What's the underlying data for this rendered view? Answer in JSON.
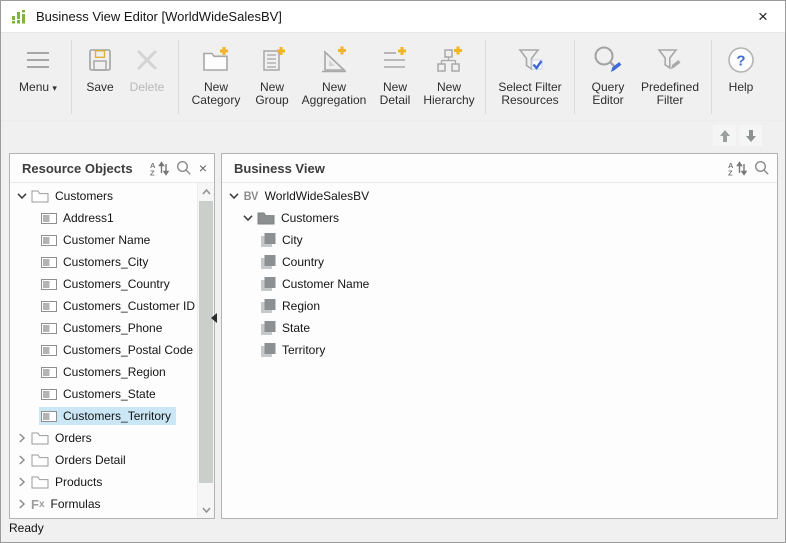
{
  "window": {
    "title": "Business View Editor [WorldWideSalesBV]"
  },
  "icons": {
    "close_window": "×",
    "dropdown_arrow": "▾",
    "panel_close": "×"
  },
  "colors": {
    "selection": "#cbe7f6",
    "brand_green": "#7cb342",
    "accent_yellow": "#f0b429",
    "accent_blue": "#3f6ad8",
    "toolbar_bg": "#f0f0f0"
  },
  "toolbar": {
    "menu_label": "Menu",
    "save_label": "Save",
    "delete_label": "Delete",
    "new_category_label": "New Category",
    "new_group_label": "New Group",
    "new_aggregation_label": "New Aggregation",
    "new_detail_label": "New Detail",
    "new_hierarchy_label": "New Hierarchy",
    "select_filter_label": "Select Filter Resources",
    "query_editor_label": "Query Editor",
    "predefined_filter_label": "Predefined Filter",
    "help_label": "Help"
  },
  "left_panel": {
    "title": "Resource Objects",
    "tree": [
      {
        "label": "Customers",
        "type": "folder",
        "state": "expanded",
        "level": 0
      },
      {
        "label": "Address1",
        "type": "field",
        "level": 1
      },
      {
        "label": "Customer Name",
        "type": "field",
        "level": 1
      },
      {
        "label": "Customers_City",
        "type": "field",
        "level": 1
      },
      {
        "label": "Customers_Country",
        "type": "field",
        "level": 1
      },
      {
        "label": "Customers_Customer ID",
        "type": "field",
        "level": 1
      },
      {
        "label": "Customers_Phone",
        "type": "field",
        "level": 1
      },
      {
        "label": "Customers_Postal Code",
        "type": "field",
        "level": 1
      },
      {
        "label": "Customers_Region",
        "type": "field",
        "level": 1
      },
      {
        "label": "Customers_State",
        "type": "field",
        "level": 1
      },
      {
        "label": "Customers_Territory",
        "type": "field",
        "level": 1,
        "selected": true
      },
      {
        "label": "Orders",
        "type": "folder",
        "state": "collapsed",
        "level": 0
      },
      {
        "label": "Orders Detail",
        "type": "folder",
        "state": "collapsed",
        "level": 0
      },
      {
        "label": "Products",
        "type": "folder",
        "state": "collapsed",
        "level": 0
      },
      {
        "label": "Formulas",
        "type": "formula",
        "state": "collapsed",
        "level": 0
      }
    ]
  },
  "right_panel": {
    "title": "Business View",
    "tree": [
      {
        "label": "WorldWideSalesBV",
        "type": "bv",
        "state": "expanded",
        "level": 0
      },
      {
        "label": "Customers",
        "type": "folder-gray",
        "state": "expanded",
        "level": 1
      },
      {
        "label": "City",
        "type": "element",
        "level": 2
      },
      {
        "label": "Country",
        "type": "element",
        "level": 2
      },
      {
        "label": "Customer Name",
        "type": "element",
        "level": 2
      },
      {
        "label": "Region",
        "type": "element",
        "level": 2
      },
      {
        "label": "State",
        "type": "element",
        "level": 2
      },
      {
        "label": "Territory",
        "type": "element",
        "level": 2
      }
    ]
  },
  "statusbar": {
    "text": "Ready"
  }
}
